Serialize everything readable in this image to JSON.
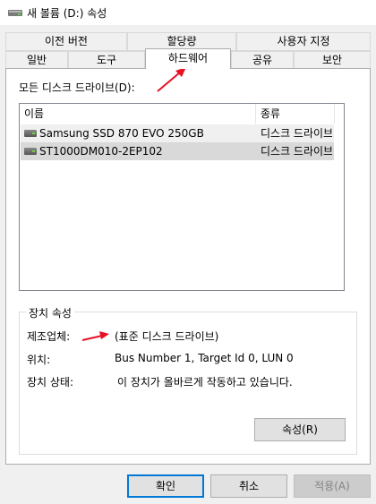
{
  "window": {
    "title": "새 볼륨 (D:) 속성",
    "icon": "drive-icon"
  },
  "tabs_top": [
    "이전 버전",
    "할당량",
    "사용자 지정"
  ],
  "tabs_bottom": [
    "일반",
    "도구",
    "하드웨어",
    "공유",
    "보안"
  ],
  "active_tab": "하드웨어",
  "all_drives_label": "모든 디스크 드라이브(D):",
  "list": {
    "columns": [
      "이름",
      "종류"
    ],
    "rows": [
      {
        "name": "Samsung SSD 870 EVO 250GB",
        "type": "디스크 드라이브"
      },
      {
        "name": "ST1000DM010-2EP102",
        "type": "디스크 드라이브"
      }
    ]
  },
  "device_props": {
    "title": "장치 속성",
    "manufacturer_label": "제조업체:",
    "manufacturer_value": "(표준 디스크 드라이브)",
    "location_label": "위치:",
    "location_value": "Bus Number 1, Target Id 0, LUN 0",
    "status_label": "장치 상태:",
    "status_value": "이 장치가 올바르게 작동하고 있습니다.",
    "properties_button": "속성(R)"
  },
  "buttons": {
    "ok": "확인",
    "cancel": "취소",
    "apply": "적용(A)"
  },
  "colors": {
    "accent": "#0078d7",
    "annotation_arrow": "#e81123",
    "selected_row": "#d9d9d9"
  }
}
